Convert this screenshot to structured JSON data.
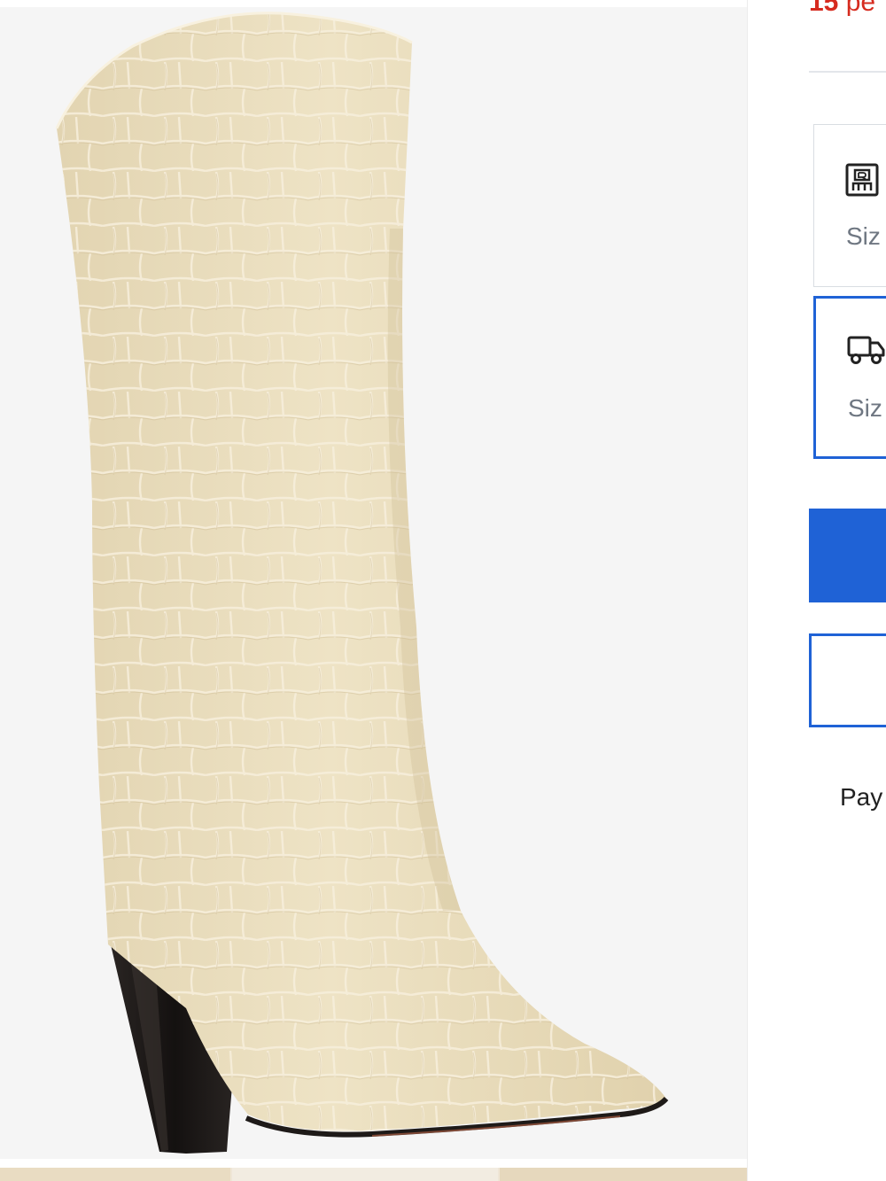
{
  "product": {
    "image_alt": "Cream croc-embossed knee-high pointed-toe boot with black block heel",
    "colors": {
      "leather": "#ebdfbf",
      "leather_shadow": "#d9c9a2",
      "crease": "#f6eedb",
      "heel": "#1e1a18",
      "backdrop": "#f5f5f5"
    }
  },
  "promo": {
    "number": "15",
    "rest": "pe"
  },
  "fulfillment": {
    "pickup": {
      "icon": "store-icon",
      "label": "Siz"
    },
    "ship": {
      "icon": "truck-icon",
      "label": "Siz",
      "selected": true
    }
  },
  "actions": {
    "primary_label": "",
    "secondary_label": ""
  },
  "payment": {
    "label": "Pay"
  },
  "theme": {
    "accent": "#1f62d6",
    "promo": "#d62b1f",
    "muted_text": "#6f7782"
  }
}
